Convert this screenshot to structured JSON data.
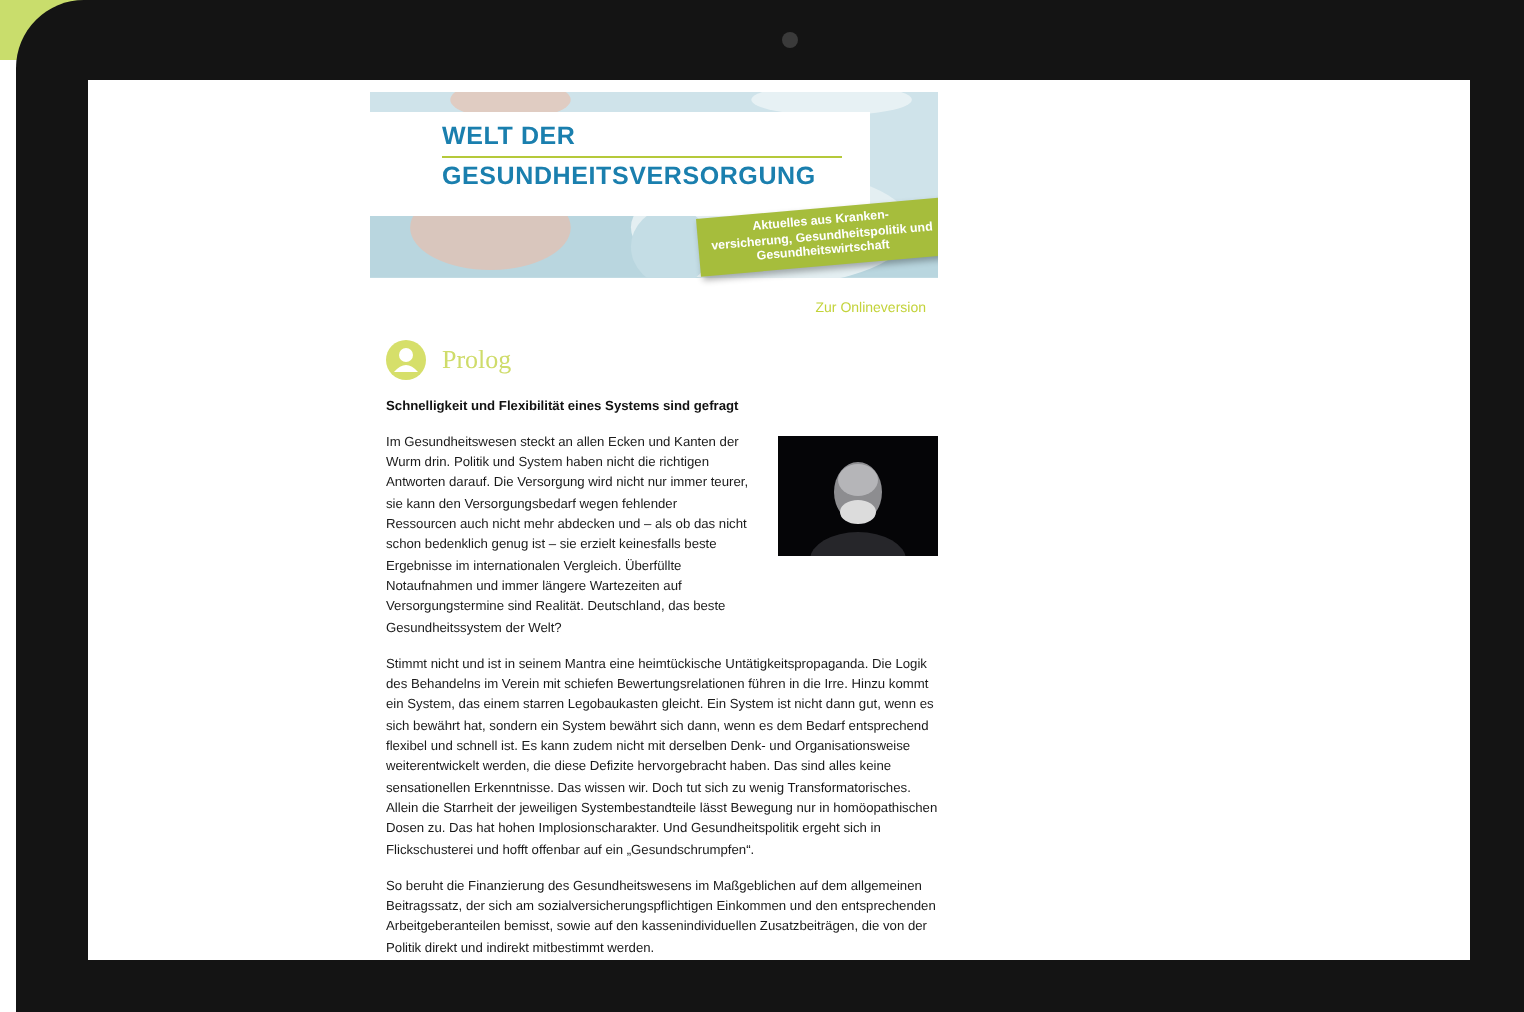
{
  "header": {
    "title_lines": [
      "WELT DER",
      "GESUNDHEITSVERSORGUNG"
    ],
    "ribbon": "Aktuelles aus Kranken-\nversicherung, Gesundheitspolitik und\nGesundheitswirtschaft"
  },
  "online_link": "Zur Onlineversion",
  "section": {
    "title": "Prolog"
  },
  "headline": "Schnelligkeit und Flexibilität eines Systems sind gefragt",
  "paragraphs": [
    "Im Gesundheitswesen steckt an allen Ecken und Kanten der Wurm drin. Politik und System haben nicht die richtigen Antworten darauf. Die Versorgung wird nicht nur immer teurer, sie kann den Versorgungsbedarf wegen fehlender Ressourcen auch nicht mehr abdecken und – als ob das nicht schon bedenklich genug ist – sie erzielt keinesfalls beste Ergebnisse im internationalen Vergleich. Überfüllte Notaufnahmen und immer längere Wartezeiten auf Versorgungstermine sind Realität. Deutschland, das beste Gesundheitssystem der Welt?",
    "Stimmt nicht und ist in seinem Mantra eine heimtückische Untätigkeitspropaganda. Die Logik des Behandelns im Verein mit schiefen Bewertungsrelationen führen in die Irre. Hinzu kommt ein System, das einem starren Legobaukasten gleicht. Ein System ist nicht dann gut, wenn es sich bewährt hat, sondern ein System bewährt sich dann, wenn es dem Bedarf entsprechend flexibel und schnell ist. Es kann zudem nicht mit derselben Denk- und Organisationsweise weiterentwickelt werden, die diese Defizite hervorgebracht haben. Das sind alles keine sensationellen Erkenntnisse. Das wissen wir. Doch tut sich zu wenig Transformatorisches. Allein die Starrheit der jeweiligen Systembestandteile lässt Bewegung nur in homöopathischen Dosen zu. Das hat hohen Implosionscharakter. Und Gesundheitspolitik ergeht sich in Flickschusterei und hofft offenbar auf ein „Gesundschrumpfen“.",
    "So beruht die Finanzierung des Gesundheitswesens im Maßgeblichen auf dem allgemeinen Beitragssatz, der sich am sozialversicherungspflichtigen Einkommen und den entsprechenden Arbeitgeberanteilen bemisst, sowie auf den kassenindividuellen Zusatzbeiträgen, die von der Politik direkt und indirekt mitbestimmt werden."
  ]
}
